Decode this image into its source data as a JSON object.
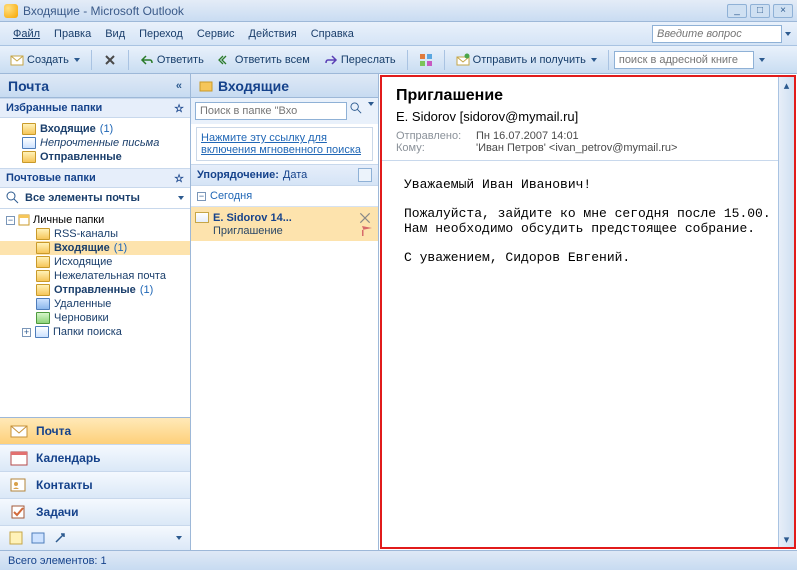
{
  "window": {
    "title": "Входящие - Microsoft Outlook"
  },
  "menu": {
    "file": "Файл",
    "edit": "Правка",
    "view": "Вид",
    "go": "Переход",
    "tools": "Сервис",
    "actions": "Действия",
    "help": "Справка",
    "ask_placeholder": "Введите вопрос"
  },
  "toolbar": {
    "create": "Создать",
    "reply": "Ответить",
    "reply_all": "Ответить всем",
    "forward": "Переслать",
    "send_receive": "Отправить и получить",
    "addr_search_placeholder": "поиск в адресной книге"
  },
  "nav": {
    "header": "Почта",
    "fav_header": "Избранные папки",
    "fav": [
      {
        "label": "Входящие",
        "count": "(1)",
        "bold": true
      },
      {
        "label": "Непрочтенные письма",
        "bold": false,
        "italic": true
      },
      {
        "label": "Отправленные",
        "bold": true
      }
    ],
    "mail_folders_header": "Почтовые папки",
    "all_items": "Все элементы почты",
    "root": "Личные папки",
    "tree": [
      {
        "label": "RSS-каналы",
        "icon": "folder"
      },
      {
        "label": "Входящие",
        "count": "(1)",
        "bold": true,
        "sel": true,
        "icon": "folder"
      },
      {
        "label": "Исходящие",
        "icon": "out"
      },
      {
        "label": "Нежелательная почта",
        "icon": "folder"
      },
      {
        "label": "Отправленные",
        "count": "(1)",
        "bold": true,
        "icon": "folder"
      },
      {
        "label": "Удаленные",
        "icon": "blue"
      },
      {
        "label": "Черновики",
        "icon": "green"
      },
      {
        "label": "Папки поиска",
        "icon": "srch",
        "twisty": true
      }
    ],
    "buttons": {
      "mail": "Почта",
      "calendar": "Календарь",
      "contacts": "Контакты",
      "tasks": "Задачи"
    }
  },
  "list": {
    "header": "Входящие",
    "search_placeholder": "Поиск в папке \"Вхо",
    "hint": "Нажмите эту ссылку для включения мгновенного поиска",
    "arrange_label": "Упорядочение:",
    "arrange_by": "Дата",
    "group": "Сегодня",
    "msg": {
      "from": "E. Sidorov 14...",
      "subject": "Приглашение"
    }
  },
  "read": {
    "subject": "Приглашение",
    "from": "E. Sidorov [sidorov@mymail.ru]",
    "sent_label": "Отправлено:",
    "sent_value": "Пн 16.07.2007 14:01",
    "to_label": "Кому:",
    "to_value": "'Иван Петров' <ivan_petrov@mymail.ru>",
    "body_p1": "Уважаемый Иван Иванович!",
    "body_p2": "Пожалуйста, зайдите ко мне сегодня после 15.00. Нам необходимо обсудить предстоящее собрание.",
    "body_p3": "С уважением, Сидоров Евгений."
  },
  "status": {
    "text": "Всего элементов: 1"
  }
}
